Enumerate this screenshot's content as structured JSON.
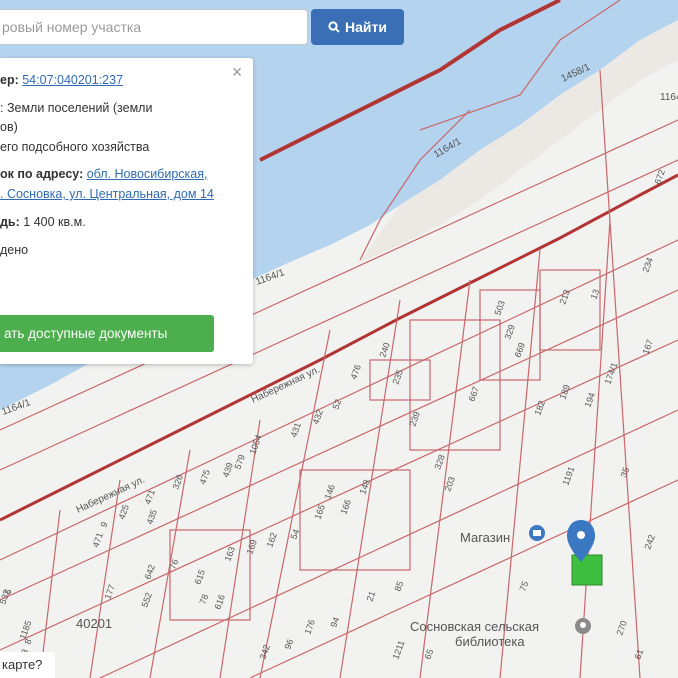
{
  "search": {
    "placeholder": "ровый номер участка",
    "button_label": "Найти"
  },
  "info": {
    "number_label": "ер:",
    "number_value": "54:07:040201:237",
    "category_line1": ": Земли поселений (земли",
    "category_line2": "ов)",
    "use_line": "его подсобного хозяйства",
    "address_label": "ок по адресу:",
    "address_line1": "обл. Новосибирская,",
    "address_line2": ". Сосновка, ул. Центральная, дом 14",
    "area_label": "дь:",
    "area_value": "1 400 кв.м.",
    "status": "дено",
    "docs_button": "ать доступные документы"
  },
  "map": {
    "colors": {
      "water": "#b4d3ee",
      "land": "#f2f2f0",
      "parcel_line": "#c9676a",
      "boundary": "#b23535",
      "marker": "#3a78c2",
      "highlight": "#3fbf3f"
    },
    "streets": [
      "Набережная ул.",
      "Набережная ул."
    ],
    "block_label": "40201",
    "water_labels": [
      "1164/1",
      "1164/1",
      "1164/1",
      "1458/1",
      "1164/1"
    ],
    "parcel_numbers": [
      "240",
      "235",
      "239",
      "328",
      "203",
      "476",
      "52",
      "432",
      "431",
      "1054",
      "579",
      "439",
      "475",
      "326",
      "471",
      "425",
      "9",
      "471",
      "146",
      "148",
      "166",
      "165",
      "54",
      "162",
      "169",
      "163",
      "615",
      "616",
      "642",
      "76",
      "78",
      "552",
      "177",
      "435",
      "5",
      "503",
      "329",
      "669",
      "213",
      "13",
      "182",
      "189",
      "194",
      "174/1",
      "667",
      "234",
      "167",
      "35",
      "1191",
      "242",
      "75",
      "85",
      "21",
      "65",
      "1211",
      "342",
      "176",
      "94",
      "1185",
      "93",
      "270",
      "61",
      "672",
      "532",
      "8",
      "96"
    ],
    "poi": [
      {
        "label": "Магазин",
        "icon": "shop-icon"
      },
      {
        "label": "Сосновская сельская",
        "icon": "library-icon"
      },
      {
        "label": "библиотека",
        "icon": "library-icon"
      }
    ]
  },
  "bottom_link": "карте?"
}
